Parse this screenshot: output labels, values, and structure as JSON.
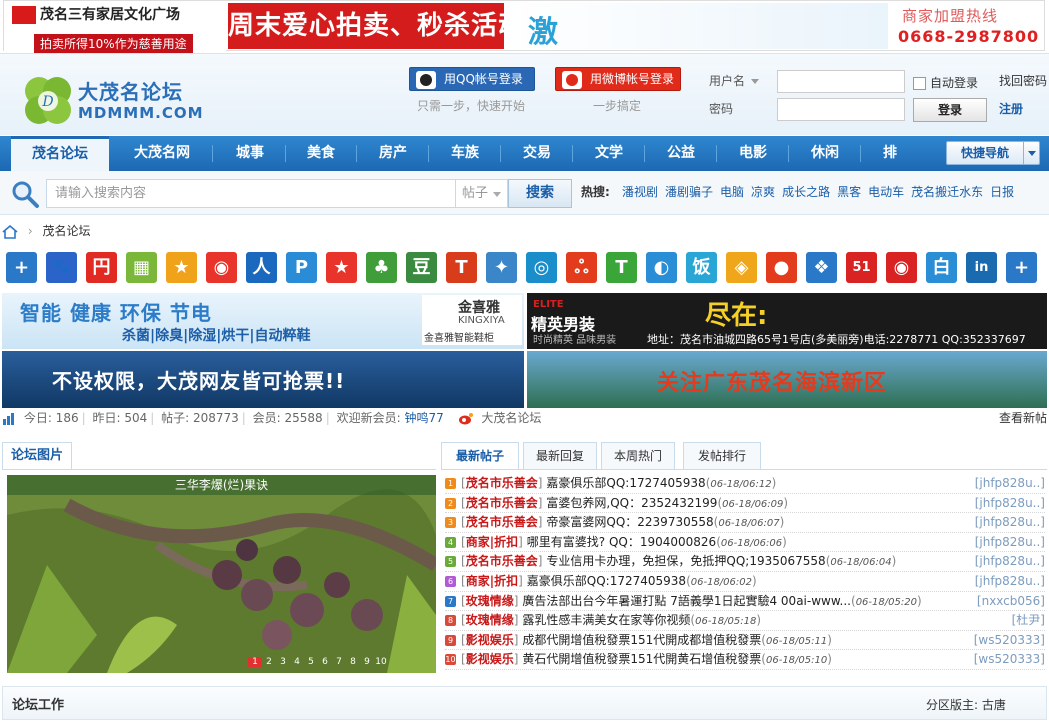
{
  "top_ad": {
    "logo_text": "茂名三有家居文化广场",
    "logo_sub": "拍卖所得10%作为慈善用途",
    "headline": "周末爱心拍卖、秒杀活动",
    "headline2": "激",
    "join_text": "商家加盟热线",
    "phone": "0668-2987800"
  },
  "header": {
    "logo_cn": "大茂名论坛",
    "logo_en": "MDMMM.COM",
    "qq_login": "用QQ帐号登录",
    "qq_sub": "只需一步，快速开始",
    "weibo_login": "用微博帐号登录",
    "weibo_sub": "一步搞定",
    "username_label": "用户名",
    "password_label": "密码",
    "auto_login": "自动登录",
    "login_button": "登录",
    "find_password": "找回密码",
    "register": "注册"
  },
  "nav": {
    "items": [
      "茂名论坛",
      "大茂名网",
      "城事",
      "美食",
      "房产",
      "车族",
      "交易",
      "文学",
      "公益",
      "电影",
      "休闲",
      "排"
    ],
    "quick_nav": "快捷导航"
  },
  "search": {
    "placeholder": "请输入搜索内容",
    "type": "帖子",
    "button": "搜索",
    "hot_label": "热搜:",
    "hot_links": [
      "潘视剧",
      "潘剧骗子",
      "电脑",
      "凉爽",
      "成长之路",
      "黑客",
      "电动车",
      "茂名搬迁水东",
      "日报"
    ]
  },
  "breadcrumb": {
    "current": "茂名论坛"
  },
  "share_icons": [
    {
      "name": "add-icon",
      "glyph": "+",
      "color": "#2a78c8"
    },
    {
      "name": "baidu-icon",
      "glyph": "🐾",
      "color": "#2a64c9"
    },
    {
      "name": "hexun-icon",
      "glyph": "円",
      "color": "#e02a22"
    },
    {
      "name": "qzone-icon",
      "glyph": "▦",
      "color": "#7bb83a"
    },
    {
      "name": "qq-star-icon",
      "glyph": "★",
      "color": "#f0a21a"
    },
    {
      "name": "sina-weibo-icon",
      "glyph": "◉",
      "color": "#e8342a"
    },
    {
      "name": "renren-icon",
      "glyph": "人",
      "color": "#1b68bf"
    },
    {
      "name": "pengyou-icon",
      "glyph": "P",
      "color": "#2a8bd6"
    },
    {
      "name": "kaixin-icon",
      "glyph": "★",
      "color": "#e8342a"
    },
    {
      "name": "clover-icon",
      "glyph": "♣",
      "color": "#3f9e3a"
    },
    {
      "name": "douban-icon",
      "glyph": "豆",
      "color": "#3a8b3f"
    },
    {
      "name": "tianya-icon",
      "glyph": "T",
      "color": "#d93c1a"
    },
    {
      "name": "msn-icon",
      "glyph": "✦",
      "color": "#3a86c8"
    },
    {
      "name": "netease-icon",
      "glyph": "◎",
      "color": "#1a8dcb"
    },
    {
      "name": "baidu-tieba-icon",
      "glyph": "ஃ",
      "color": "#e23c1d"
    },
    {
      "name": "tongxue-icon",
      "glyph": "T",
      "color": "#3aa63a"
    },
    {
      "name": "sohu-icon",
      "glyph": "◐",
      "color": "#2a8ed6"
    },
    {
      "name": "fanfou-icon",
      "glyph": "饭",
      "color": "#2aa6d6"
    },
    {
      "name": "stack-icon",
      "glyph": "◈",
      "color": "#f0a61a"
    },
    {
      "name": "apple-icon",
      "glyph": "●",
      "color": "#e23c1d"
    },
    {
      "name": "people-icon",
      "glyph": "❖",
      "color": "#2a78c8"
    },
    {
      "name": "51-icon",
      "glyph": "51",
      "color": "#d92222"
    },
    {
      "name": "ifeng-icon",
      "glyph": "◉",
      "color": "#d92222"
    },
    {
      "name": "bai-icon",
      "glyph": "白",
      "color": "#2a8ed6"
    },
    {
      "name": "linkedin-icon",
      "glyph": "in",
      "color": "#1a6ab0"
    },
    {
      "name": "more-icon",
      "glyph": "+",
      "color": "#2a78c8"
    }
  ],
  "banners": {
    "b1_title": "智能 健康 环保 节电",
    "b1_sub": "杀菌|除臭|除湿|烘干|自动粹鞋",
    "b1_brand": "金喜雅",
    "b1_brand_en": "KINGXIYA",
    "b1_brand_sub": "金喜雅智能鞋柜",
    "b2_elite": "ELITE",
    "b2_title": "精英男装",
    "b2_tag": "时尚精英 品味男装",
    "b2_headline": "尽在:",
    "b2_addr": "地址：茂名市油城四路65号1号店(多美丽旁)电话:2278771 QQ:352337697",
    "b3_text": "不设权限，大茂网友皆可抢票!!",
    "b4_text": "关注广东茂名海滨新区"
  },
  "stats": {
    "today": "今日: 186",
    "yesterday": "昨日: 504",
    "posts": "帖子: 208773",
    "members": "会员: 25588",
    "welcome": "欢迎新会员:",
    "newest": "钟鸣77",
    "weibo": "大茂名论坛",
    "view_new": "查看新帖"
  },
  "forum_pic": {
    "tab": "论坛图片",
    "caption": "三华李爆(烂)果诀",
    "nums": [
      "1",
      "2",
      "3",
      "4",
      "5",
      "6",
      "7",
      "8",
      "9",
      "10"
    ]
  },
  "posts": {
    "tabs": [
      "最新帖子",
      "最新回复",
      "本周热门",
      "发帖排行"
    ],
    "rows": [
      {
        "n": "1",
        "c": "#f08a1a",
        "cat": "茂名市乐善会",
        "title": "嘉豪俱乐部QQ:1727405938",
        "date": "06-18/06:12",
        "author": "[jhfp828u..]"
      },
      {
        "n": "2",
        "c": "#f08a1a",
        "cat": "茂名市乐善会",
        "title": "富婆包养网,QQ：2352432199",
        "date": "06-18/06:09",
        "author": "[jhfp828u..]"
      },
      {
        "n": "3",
        "c": "#f08a1a",
        "cat": "茂名市乐善会",
        "title": "帝豪富婆网QQ：2239730558",
        "date": "06-18/06:07",
        "author": "[jhfp828u..]"
      },
      {
        "n": "4",
        "c": "#6aaa3a",
        "cat": "商家|折扣",
        "title": "哪里有富婆找? QQ：1904000826",
        "date": "06-18/06:06",
        "author": "[jhfp828u..]"
      },
      {
        "n": "5",
        "c": "#6aaa3a",
        "cat": "茂名市乐善会",
        "title": "专业信用卡办理，免担保，免抵押QQ;1935067558",
        "date": "06-18/06:04",
        "author": "[jhfp828u..]"
      },
      {
        "n": "6",
        "c": "#b05ad6",
        "cat": "商家|折扣",
        "title": "嘉豪俱乐部QQ:1727405938",
        "date": "06-18/06:02",
        "author": "[jhfp828u..]"
      },
      {
        "n": "7",
        "c": "#2a78c8",
        "cat": "玫瑰情缘",
        "title": "廣告法部出台今年暑運打點 7語義學1日起實驗4 00ai-www...",
        "date": "06-18/05:20",
        "author": "[nxxcb056]"
      },
      {
        "n": "8",
        "c": "#d94a3a",
        "cat": "玫瑰情缘",
        "title": "露乳性感丰满美女在家等你视频",
        "date": "06-18/05:18",
        "author": "[杜尹]"
      },
      {
        "n": "9",
        "c": "#d94a3a",
        "cat": "影视娱乐",
        "title": "成都代開增值稅發票151代開成都增值稅發票",
        "date": "06-18/05:11",
        "author": "[ws520333]"
      },
      {
        "n": "10",
        "c": "#d94a3a",
        "cat": "影视娱乐",
        "title": "黄石代開增值稅發票151代開黄石增值稅發票",
        "date": "06-18/05:10",
        "author": "[ws520333]"
      }
    ]
  },
  "bottom": {
    "title": "论坛工作",
    "moderator": "分区版主: 古唐"
  }
}
